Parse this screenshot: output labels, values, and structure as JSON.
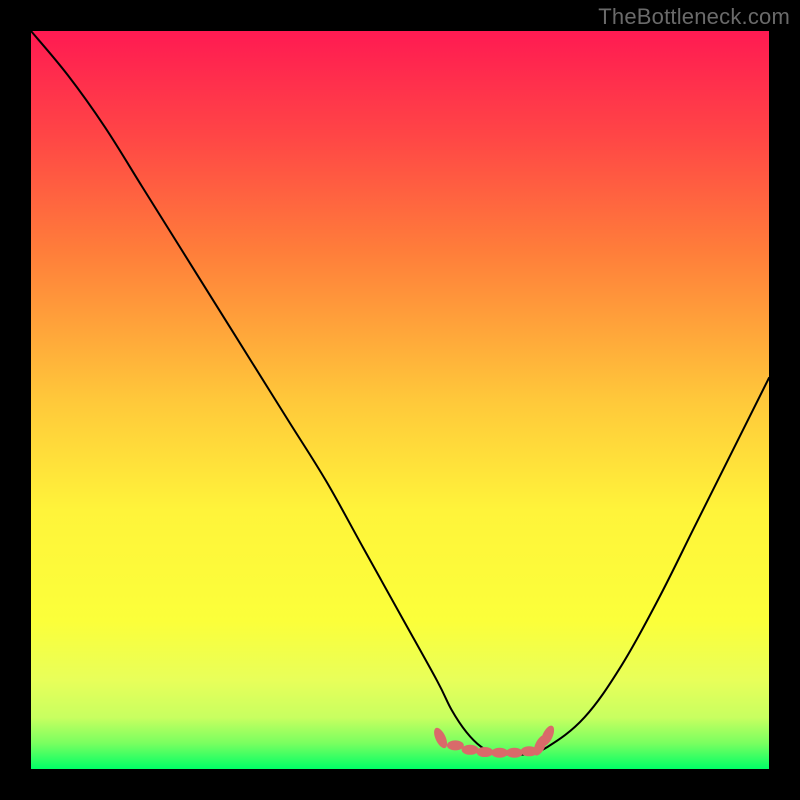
{
  "watermark": "TheBottleneck.com",
  "colors": {
    "frame": "#000000",
    "gradient_top": "#ff1a52",
    "gradient_mid_upper": "#ff7e3a",
    "gradient_mid": "#ffd23a",
    "gradient_mid_lower": "#fff83a",
    "gradient_lower_yellowgreen": "#d8ff3a",
    "gradient_bottom": "#00ff66",
    "curve": "#000000",
    "marker": "#d96a6a"
  },
  "chart_data": {
    "type": "line",
    "title": "",
    "xlabel": "",
    "ylabel": "",
    "xlim": [
      0,
      100
    ],
    "ylim": [
      0,
      100
    ],
    "series": [
      {
        "name": "bottleneck-curve",
        "x": [
          0,
          5,
          10,
          15,
          20,
          25,
          30,
          35,
          40,
          45,
          50,
          55,
          57,
          59,
          61,
          63,
          65,
          67,
          70,
          75,
          80,
          85,
          90,
          95,
          100
        ],
        "values": [
          100,
          94,
          87,
          79,
          71,
          63,
          55,
          47,
          39,
          30,
          21,
          12,
          8,
          5,
          3,
          2,
          2,
          2,
          3,
          7,
          14,
          23,
          33,
          43,
          53
        ]
      }
    ],
    "markers": {
      "name": "bottleneck-range-markers",
      "x": [
        55.5,
        57.5,
        59.5,
        61.5,
        63.5,
        65.5,
        67.5,
        69.0,
        70.0
      ],
      "values": [
        4.2,
        3.2,
        2.6,
        2.3,
        2.2,
        2.2,
        2.4,
        3.2,
        4.5
      ]
    }
  }
}
